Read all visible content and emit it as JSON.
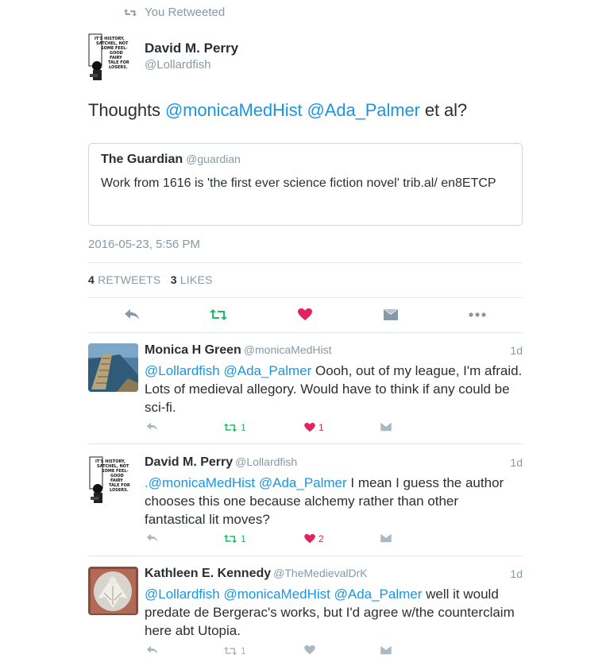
{
  "retweet_notice": "You Retweeted",
  "main_tweet": {
    "author_name": "David M. Perry",
    "author_handle": "@Lollardfish",
    "avatar_text": [
      "IT'S HISTORY,",
      "SATCHEL, NOT",
      "SOME FEEL-",
      "GOOD",
      "FAIRY",
      "TALE FOR",
      "LOSERS."
    ],
    "text_prefix": "Thoughts ",
    "mention_1": "@monicaMedHist",
    "mention_2": "@Ada_Palmer",
    "text_suffix": " et al?",
    "quote": {
      "name": "The Guardian",
      "handle": "@guardian",
      "text": "Work from 1616 is 'the first ever science fiction novel' trib.al/ en8ETCP"
    },
    "timestamp": "2016-05-23, 5:56 PM",
    "stats": {
      "retweets_count": "4",
      "retweets_label": "RETWEETS",
      "likes_count": "3",
      "likes_label": "LIKES"
    }
  },
  "colors": {
    "mention": "#1b95e0",
    "retweet_active": "#17bf63",
    "like_active": "#e0245e",
    "icon_gray": "#8899a6"
  },
  "replies": [
    {
      "name": "Monica H Green",
      "handle": "@monicaMedHist",
      "time": "1d",
      "mentions": "@Lollardfish @Ada_Palmer",
      "text": " Oooh, out of my league, I'm afraid. Lots of medieval allegory. Would have to think if any could be sci-fi.",
      "retweets": "1",
      "likes": "1"
    },
    {
      "name": "David M. Perry",
      "handle": "@Lollardfish",
      "time": "1d",
      "mentions": ".@monicaMedHist @Ada_Palmer",
      "text": " I mean I guess the author chooses this one because alchemy rather than other fantastical lit moves?",
      "retweets": "1",
      "likes": "2"
    },
    {
      "name": "Kathleen E. Kennedy",
      "handle": "@TheMedievalDrK",
      "time": "1d",
      "mentions": "@Lollardfish @monicaMedHist @Ada_Palmer",
      "text": " well it would predate de Bergerac's works, but I'd agree w/the counterclaim here abt Utopia.",
      "retweets": "1",
      "likes": ""
    }
  ]
}
